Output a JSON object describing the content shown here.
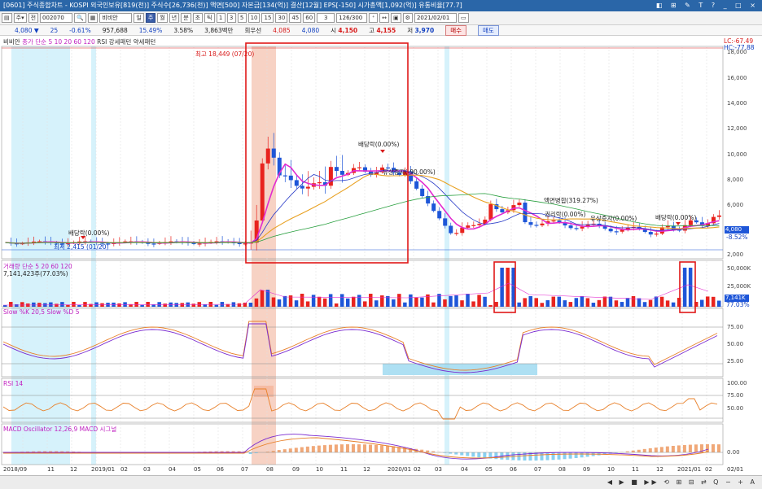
{
  "titlebar": {
    "text": "[0601] 주식종합차트 - KOSPI 외국인보유[819(천)] 주식수[26,736(천)] 액면[500] 자본금[134(억)] 결산[12월] EPS[-150] 시가총액[1,092(억)] 유통비율[77.7]",
    "controls": "◧ ⊞ ✎ T ? _ □ ×"
  },
  "toolbar": {
    "code": "002070",
    "name": "비비안",
    "period_buttons": [
      "일",
      "주",
      "월",
      "년",
      "분",
      "초",
      "틱"
    ],
    "active_period": "주",
    "minute_options": [
      "1",
      "3",
      "5",
      "10",
      "15",
      "30",
      "45",
      "60"
    ],
    "interval_value": "3",
    "count": "126/300",
    "date": "2021/02/01"
  },
  "quote": {
    "price": "4,080 ▼",
    "change": "25",
    "change_pct": "-0.61%",
    "volume": "957,688",
    "ratio1": "15.49%",
    "ratio2": "3.58%",
    "amount": "3,863백만",
    "source": "회우선",
    "v1": "4,085",
    "v2": "4,080",
    "open_label": "시",
    "open": "4,150",
    "high_label": "고",
    "high": "4,155",
    "low_label": "저",
    "low": "3,970",
    "buy_label": "매수",
    "sell_label": "매도"
  },
  "panels": {
    "price_legend": "비비안",
    "price_ma": "종가 단순 5 10 20 60 120",
    "price_rsi": "RSI 강세패턴 약세패턴",
    "volume_legend": "거래량 단순 5 20 60 120",
    "volume_value": "7,141,423주(77.03%)",
    "slow_legend": "Slow %K 20,5 Slow %D 5",
    "rsi_legend": "RSI 14",
    "macd_legend": "MACD Oscillator 12,26,9 MACD 시그널"
  },
  "annotations": {
    "high": "최고 18,449 (07/20)",
    "low": "최저 2,415 (01/20)",
    "div1": "배당락(0.00%)",
    "div2": "배당락(0.00%)",
    "div3": "배당락(0.00%)",
    "paid_in": "유상증자(-90.00%)",
    "merge": "액면병합(319.27%)",
    "rights": "권리락(0.00%)",
    "paid_in2": "유상증자(0.00%)",
    "lc": "LC:-67.49",
    "hc": "HC:-77.88",
    "cur_price": "4,080",
    "cur_pct": "-8.52%",
    "vol_cur": "7,141K",
    "vol_pct": "77.03%"
  },
  "axes": {
    "price": [
      "18,000",
      "16,000",
      "14,000",
      "12,000",
      "10,000",
      "8,000",
      "6,000",
      "2,000"
    ],
    "volume": [
      "50,000K",
      "25,000K"
    ],
    "slow": [
      "75.00",
      "50.00",
      "25.00"
    ],
    "rsi": [
      "100.00",
      "75.00",
      "50.00"
    ],
    "macd": [
      "0.00"
    ],
    "dates": [
      "2018/09",
      "11",
      "12",
      "2019/01",
      "02",
      "03",
      "04",
      "05",
      "06",
      "07",
      "08",
      "09",
      "10",
      "11",
      "12",
      "2020/01",
      "02",
      "03",
      "04",
      "05",
      "06",
      "07",
      "08",
      "09",
      "10",
      "11",
      "12",
      "2021/01",
      "02",
      "02/01"
    ]
  },
  "colors": {
    "up": "#e8231e",
    "down": "#1e56d8",
    "ma5": "#e22bd0",
    "ma10": "#2a3cc8",
    "ma20": "#e8a020",
    "ma60": "#2aa040",
    "highlight": "#f5c7b5",
    "cyan": "#d6f2fb"
  }
}
